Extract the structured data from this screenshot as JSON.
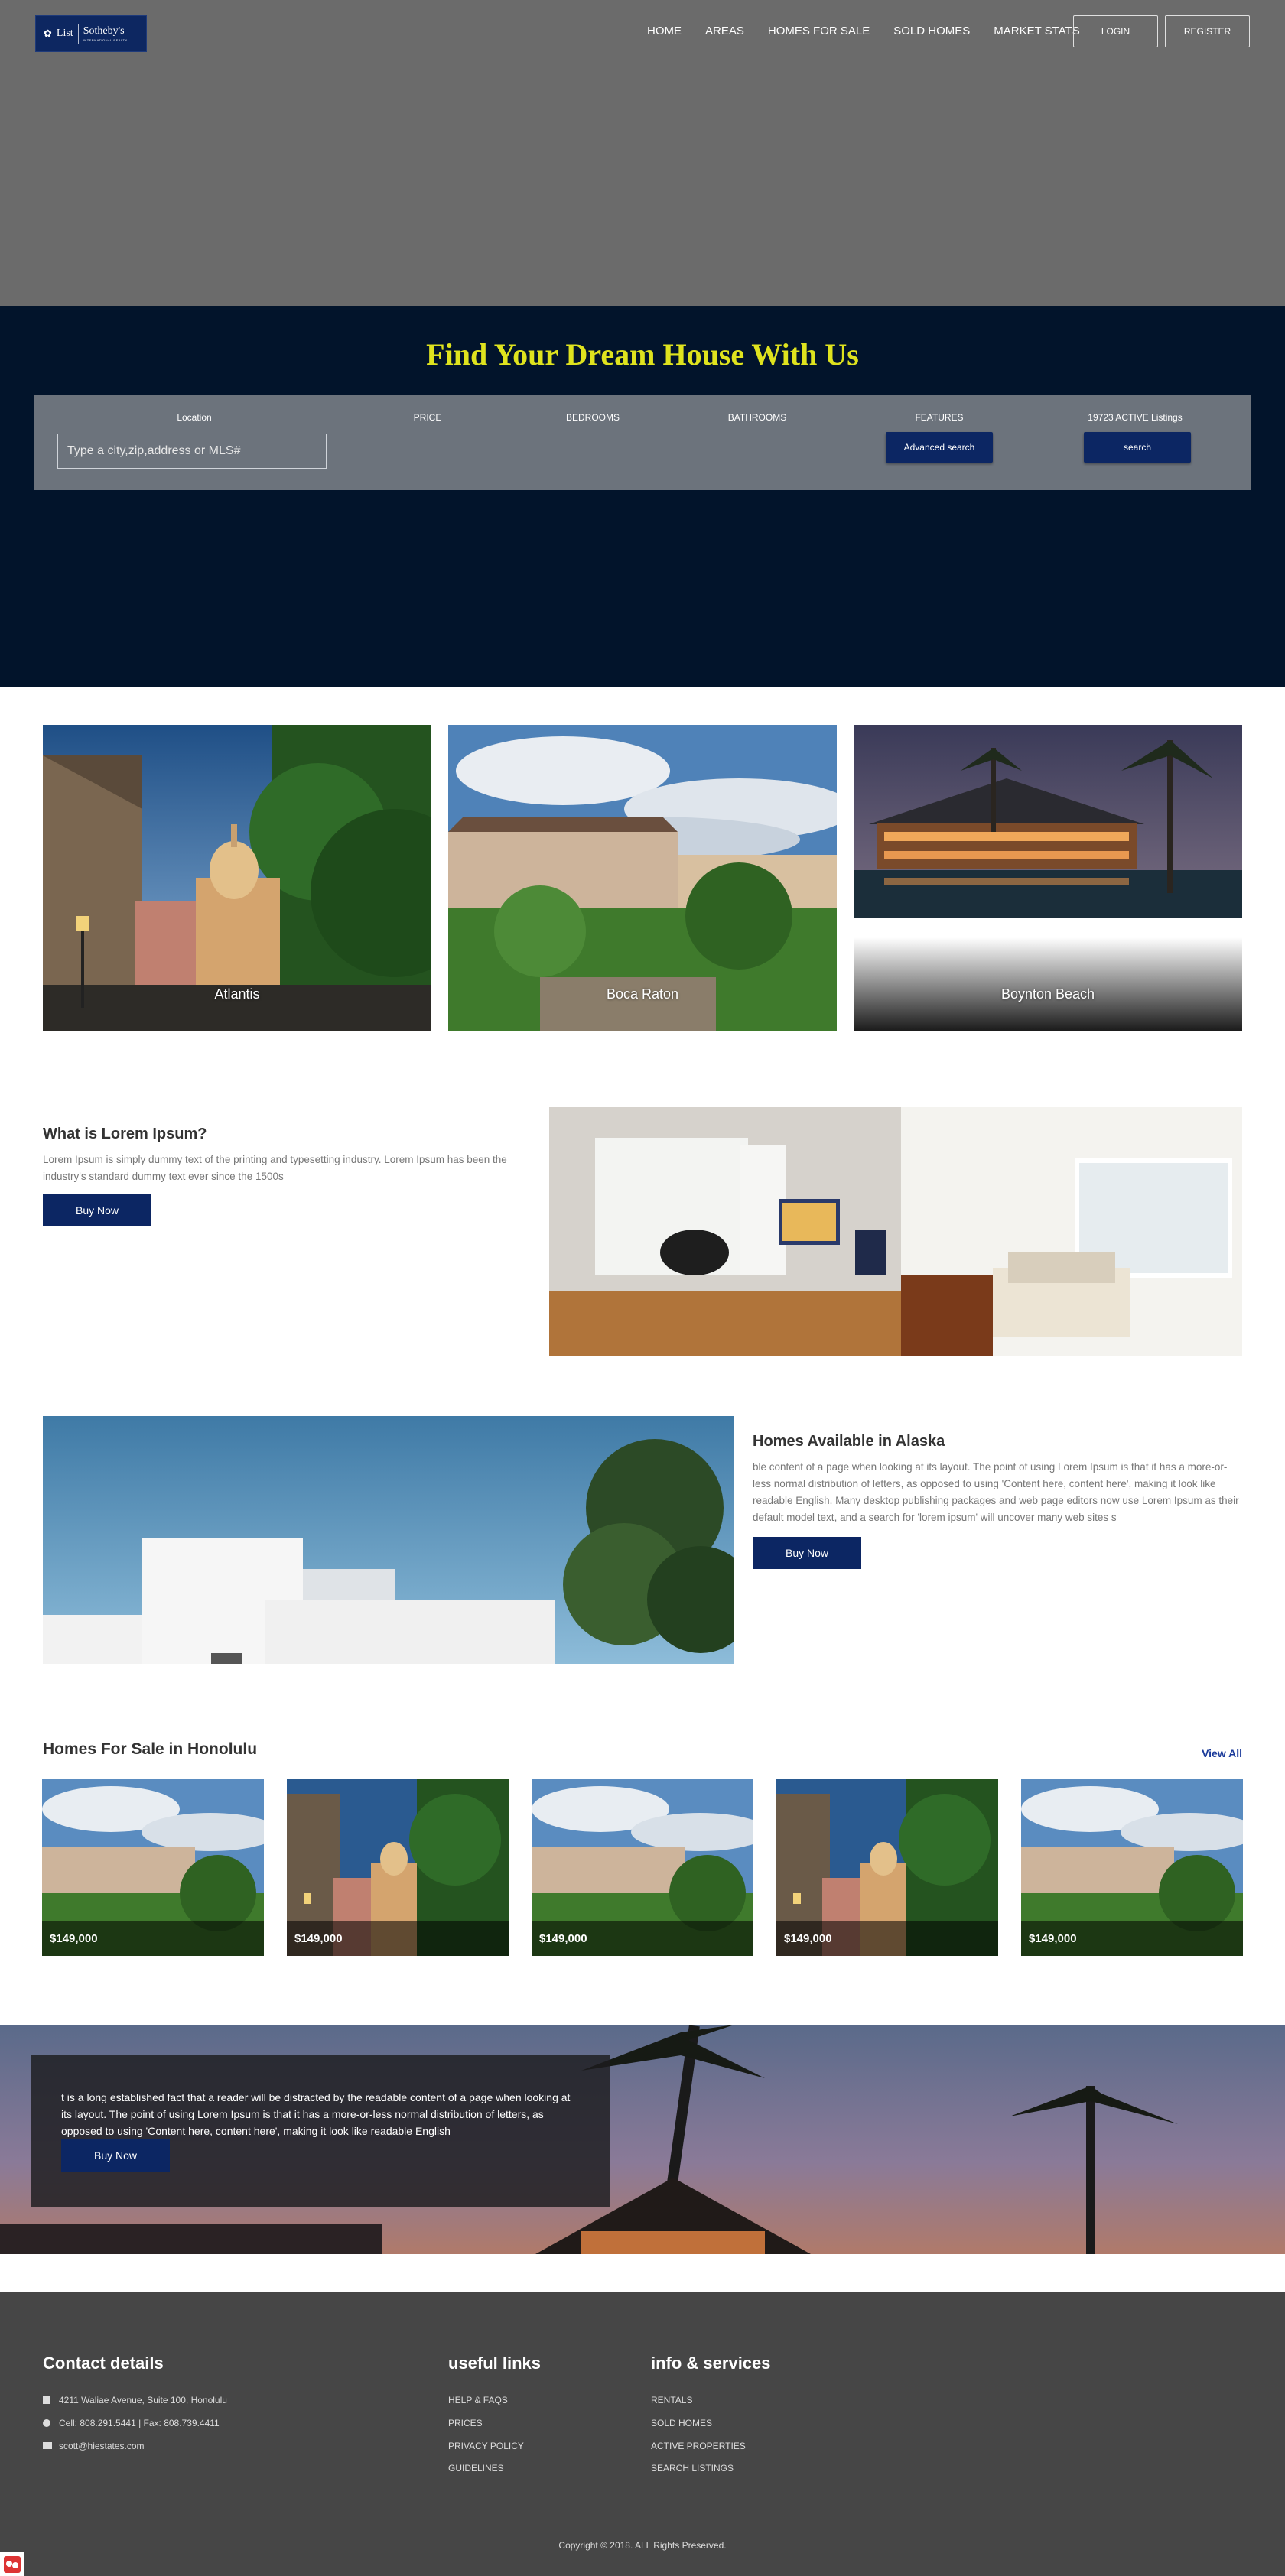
{
  "header": {
    "logo": {
      "list": "List",
      "brand": "Sotheby's",
      "brand_sub": "INTERNATIONAL REALTY"
    },
    "nav": [
      "HOME",
      "AREAS",
      "HOMES FOR SALE",
      "SOLD HOMES",
      "MARKET STATS"
    ],
    "login_label": "LOGIN",
    "register_label": "REGISTER"
  },
  "hero": {
    "title": "Find Your Dream House With Us",
    "search": {
      "location_label": "Location",
      "price_label": "PRICE",
      "bedrooms_label": "BEDROOMS",
      "bathrooms_label": "BATHROOMS",
      "features_label": "FEATURES",
      "listings_label": "19723 ACTIVE Listings",
      "location_placeholder": "Type a city,zip,address or MLS#",
      "advanced_label": "Advanced search",
      "search_label": "search"
    }
  },
  "areas": [
    {
      "name": "Atlantis"
    },
    {
      "name": "Boca Raton"
    },
    {
      "name": "Boynton Beach"
    }
  ],
  "info_1": {
    "title": "What is Lorem Ipsum?",
    "text": "Lorem Ipsum is simply dummy text of the printing and typesetting industry. Lorem Ipsum has been the industry's standard dummy text ever since the 1500s",
    "button": "Buy Now"
  },
  "info_2": {
    "title": "Homes Available in Alaska",
    "text": "ble content of a page when looking at its layout. The point of using Lorem Ipsum is that it has a more-or-less normal distribution of letters, as opposed to using 'Content here, content here', making it look like readable English. Many desktop publishing packages and web page editors now use Lorem Ipsum as their default model text, and a search for 'lorem ipsum' will uncover many web sites s",
    "button": "Buy Now"
  },
  "listings": {
    "title": "Homes For Sale in Honolulu",
    "view_all": "View All",
    "items": [
      {
        "price": "$149,000"
      },
      {
        "price": "$149,000"
      },
      {
        "price": "$149,000"
      },
      {
        "price": "$149,000"
      },
      {
        "price": "$149,000"
      }
    ]
  },
  "banner": {
    "text": "t is a long established fact that a reader will be distracted by the readable content of a page when looking at its layout. The point of using Lorem Ipsum is that it has a more-or-less normal distribution of letters, as opposed to using 'Content here, content here', making it look like readable English",
    "button": "Buy Now"
  },
  "footer": {
    "contact": {
      "title": "Contact details",
      "address": "4211 Waliae Avenue, Suite 100, Honolulu",
      "phone": "Cell: 808.291.5441 | Fax: 808.739.4411",
      "email": "scott@hiestates.com"
    },
    "useful_links": {
      "title": "useful links",
      "items": [
        "HELP & FAQS",
        "PRICES",
        "PRIVACY POLICY",
        "GUIDELINES"
      ]
    },
    "info_services": {
      "title": "info & services",
      "items": [
        "RENTALS",
        "SOLD HOMES",
        "ACTIVE PROPERTIES",
        "SEARCH LISTINGS"
      ]
    },
    "copyright": "Copyright © 2018. ALL Rights Preserved."
  },
  "colors": {
    "navy": "#0c2663",
    "hero_band": "#02142b",
    "title_yellow": "#dfe31e",
    "hero_gray": "#6b6b6b",
    "footer_bg": "#464646"
  }
}
